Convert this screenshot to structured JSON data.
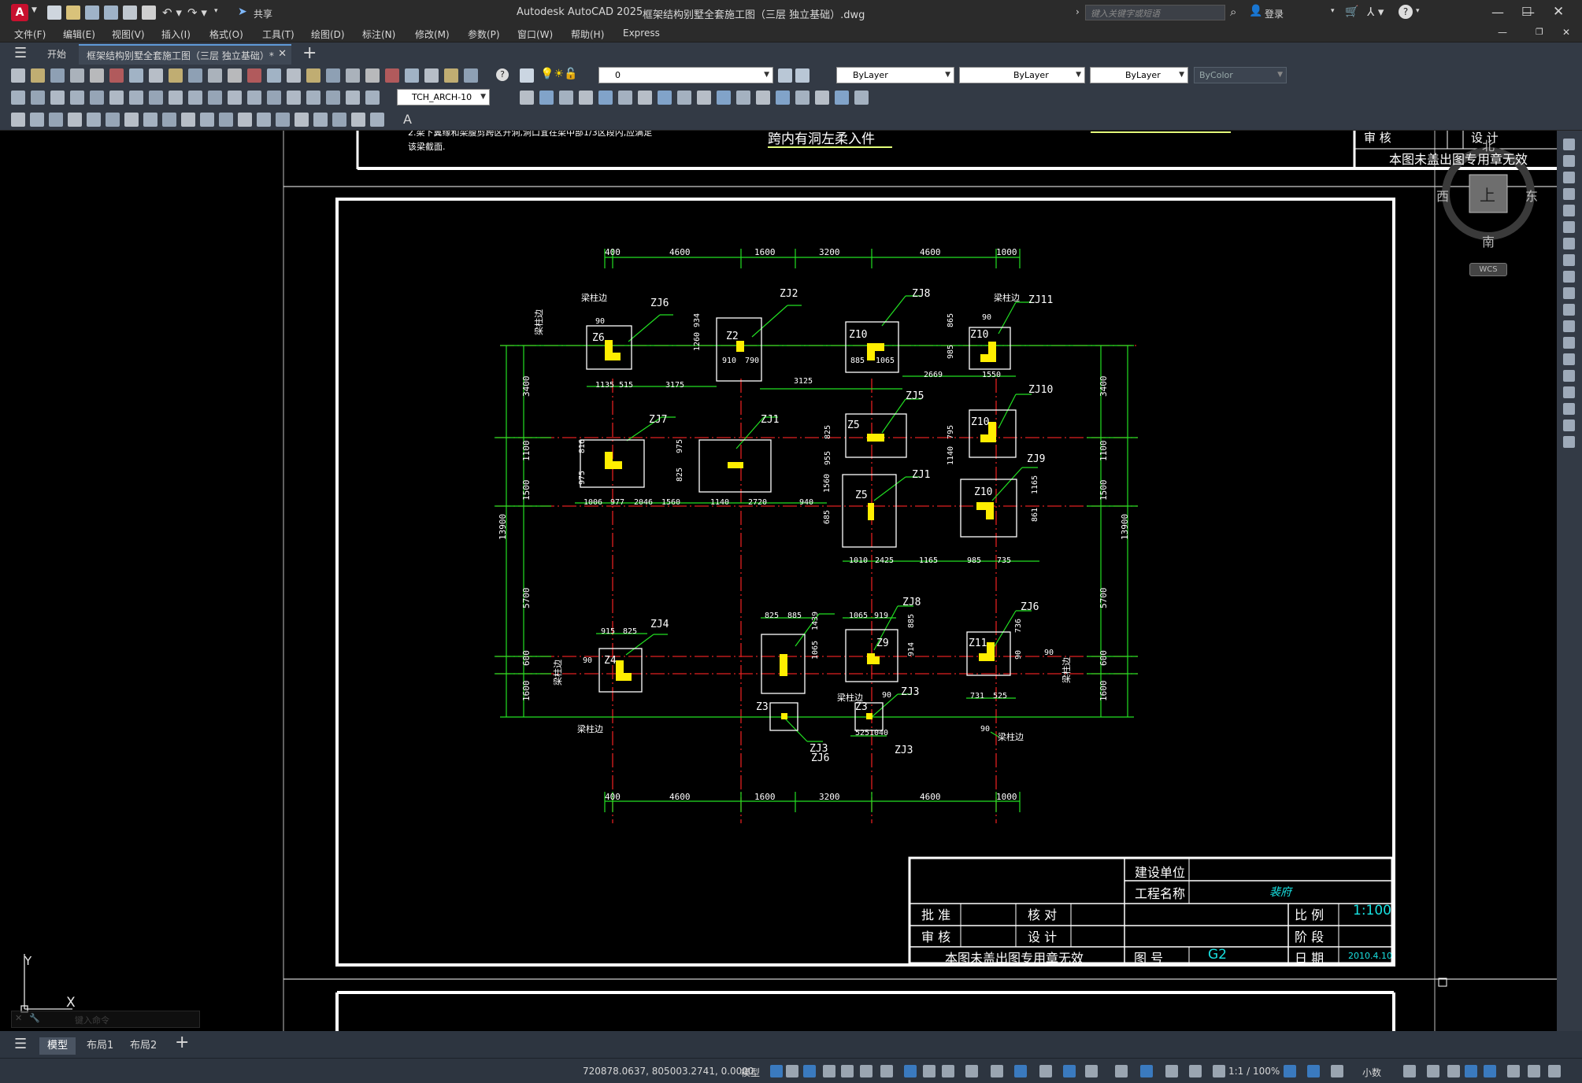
{
  "app": {
    "title": "Autodesk AutoCAD 2025",
    "doc_title": "框架结构别墅全套施工图（三层 独立基础）.dwg",
    "share_label": "共享",
    "search_placeholder": "键入关键字或短语",
    "login_label": "登录"
  },
  "menu": [
    "文件(F)",
    "编辑(E)",
    "视图(V)",
    "插入(I)",
    "格式(O)",
    "工具(T)",
    "绘图(D)",
    "标注(N)",
    "修改(M)",
    "参数(P)",
    "窗口(W)",
    "帮助(H)",
    "Express"
  ],
  "tabs": {
    "start": "开始",
    "drawing": "框架结构别墅全套施工图（三层 独立基础）*"
  },
  "toolbar": {
    "layer_value": "0",
    "color_value": "ByLayer",
    "linetype_value": "ByLayer",
    "lineweight_value": "ByLayer",
    "plotstyle_value": "ByColor",
    "dimstyle_value": "TCH_ARCH-10"
  },
  "viewcube": {
    "north": "北",
    "south": "南",
    "east": "东",
    "west": "西",
    "top": "上",
    "wcs": "WCS"
  },
  "ucs": {
    "y": "Y",
    "x": "X"
  },
  "command_placeholder": "键入命令",
  "layout_tabs": [
    "模型",
    "布局1",
    "布局2"
  ],
  "status": {
    "coords": "720878.0637, 805003.2741, 0.0000",
    "model": "模型",
    "scale": "1:1 / 100%",
    "units": "小数"
  },
  "drawing": {
    "top_note_1": "2.梁下翼缘和梁腹剪跨区开洞,洞口宜在梁中部1/3区段内,应满足",
    "top_note_2": "该梁截面.",
    "top_label": "跨内有洞左柔入件",
    "top_tb_left": "审  核",
    "top_tb_right": "设  计",
    "top_tb_stamp": "本图未盖出图专用章无效",
    "dims_top": [
      "400",
      "4600",
      "1600",
      "3200",
      "4600",
      "1000"
    ],
    "dims_bottom": [
      "400",
      "4600",
      "1600",
      "3200",
      "4600",
      "1000"
    ],
    "dims_left": [
      "3400",
      "1100",
      "1500",
      "5700",
      "600",
      "1600"
    ],
    "dims_right": [
      "3400",
      "1100",
      "1500",
      "5700",
      "600",
      "1600"
    ],
    "total_dim": "13900",
    "footings": [
      {
        "name": "Z6",
        "tag": "ZJ6"
      },
      {
        "name": "Z2",
        "tag": "ZJ2"
      },
      {
        "name": "Z10",
        "tag": "ZJ8"
      },
      {
        "name": "Z10",
        "tag": "ZJ11"
      },
      {
        "name": "Z5",
        "tag": "ZJ5"
      },
      {
        "name": "Z10",
        "tag": "ZJ10"
      },
      {
        "name": "Z5",
        "tag": "ZJ1"
      },
      {
        "name": "Z10",
        "tag": "ZJ9"
      },
      {
        "name": "Z4",
        "tag": "ZJ4"
      },
      {
        "name": "Z9",
        "tag": "ZJ8"
      },
      {
        "name": "Z11",
        "tag": "ZJ6"
      },
      {
        "name": "Z3",
        "tag": "ZJ3"
      },
      {
        "name": "Z3",
        "tag": "ZJ3"
      }
    ],
    "other_labels": [
      "ZJ7",
      "ZJ1",
      "ZJ6",
      "ZJ3"
    ],
    "misc_dims": [
      "1135",
      "515",
      "3175",
      "3125",
      "2669",
      "1550",
      "910",
      "790",
      "885",
      "1065",
      "1006",
      "977",
      "2046",
      "1560",
      "1140",
      "2720",
      "940",
      "1010",
      "2425",
      "1165",
      "985",
      "735",
      "915",
      "825",
      "825",
      "885",
      "1065",
      "919",
      "731",
      "525",
      "525",
      "1040",
      "1260",
      "934",
      "816",
      "975",
      "975",
      "825",
      "825",
      "955",
      "795",
      "1140",
      "1560",
      "685",
      "865",
      "985",
      "1165",
      "861",
      "1439",
      "1065",
      "885",
      "914",
      "736",
      "90",
      "90",
      "90",
      "90",
      "90",
      "90",
      "90"
    ],
    "beam_note": "梁柱边",
    "title_block": {
      "client_label": "建设单位",
      "project_label": "工程名称",
      "project_value": "裴府",
      "approve": "批  准",
      "check": "核  对",
      "audit": "审  核",
      "design": "设  计",
      "scale_label": "比  例",
      "scale_value": "1:100",
      "stage_label": "阶  段",
      "stamp": "本图未盖出图专用章无效",
      "dwg_no_label": "图  号",
      "dwg_no_value": "G2",
      "date_label": "日  期",
      "date_value": "2010.4.10"
    }
  }
}
